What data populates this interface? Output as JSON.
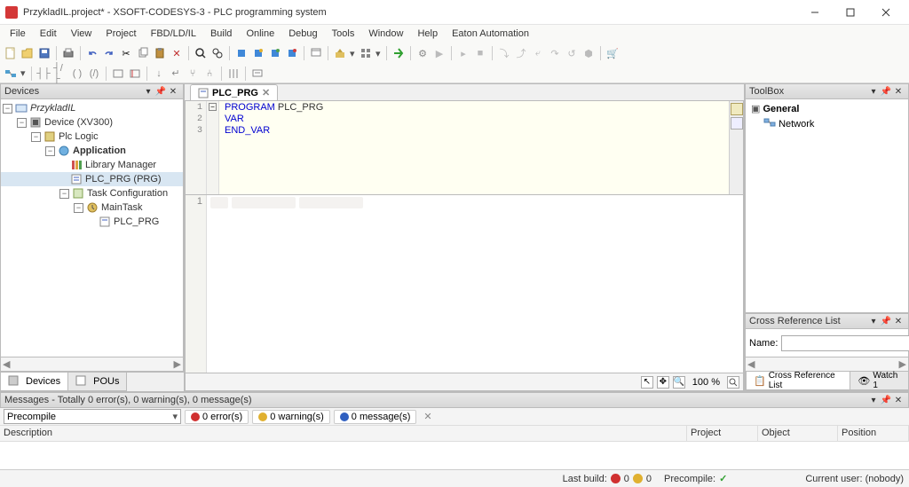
{
  "window": {
    "title": "PrzykladIL.project* - XSOFT-CODESYS-3 - PLC programming system"
  },
  "menubar": [
    "File",
    "Edit",
    "View",
    "Project",
    "FBD/LD/IL",
    "Build",
    "Online",
    "Debug",
    "Tools",
    "Window",
    "Help",
    "Eaton Automation"
  ],
  "panels": {
    "devices_title": "Devices",
    "toolbox_title": "ToolBox",
    "crossref_title": "Cross Reference List",
    "messages_title": "Messages - Totally 0 error(s), 0 warning(s), 0 message(s)"
  },
  "device_tree": {
    "root": "PrzykladIL",
    "device": "Device (XV300)",
    "plc_logic": "Plc Logic",
    "application": "Application",
    "library_mgr": "Library Manager",
    "plc_prg": "PLC_PRG (PRG)",
    "task_config": "Task Configuration",
    "main_task": "MainTask",
    "task_plc_prg": "PLC_PRG"
  },
  "left_tabs": {
    "devices": "Devices",
    "pous": "POUs"
  },
  "editor": {
    "tab_label": "PLC_PRG",
    "lines": [
      {
        "n": "1",
        "kw": "PROGRAM",
        "rest": "PLC_PRG"
      },
      {
        "n": "2",
        "kw": "VAR",
        "rest": ""
      },
      {
        "n": "3",
        "kw": "END_VAR",
        "rest": ""
      }
    ],
    "impl_line_no": "1",
    "zoom": "100 %"
  },
  "toolbox": {
    "group_general": "General",
    "item_network": "Network"
  },
  "crossref": {
    "name_label": "Name:",
    "value": "",
    "tab1": "Cross Reference List",
    "tab2": "Watch 1"
  },
  "messages": {
    "combo_value": "Precompile",
    "errors": "0 error(s)",
    "warnings": "0 warning(s)",
    "msgs": "0 message(s)",
    "col_desc": "Description",
    "col_proj": "Project",
    "col_obj": "Object",
    "col_pos": "Position"
  },
  "statusbar": {
    "lastbuild_label": "Last build:",
    "lastbuild_err": "0",
    "lastbuild_warn": "0",
    "precompile_label": "Precompile:",
    "user": "Current user: (nobody)"
  }
}
